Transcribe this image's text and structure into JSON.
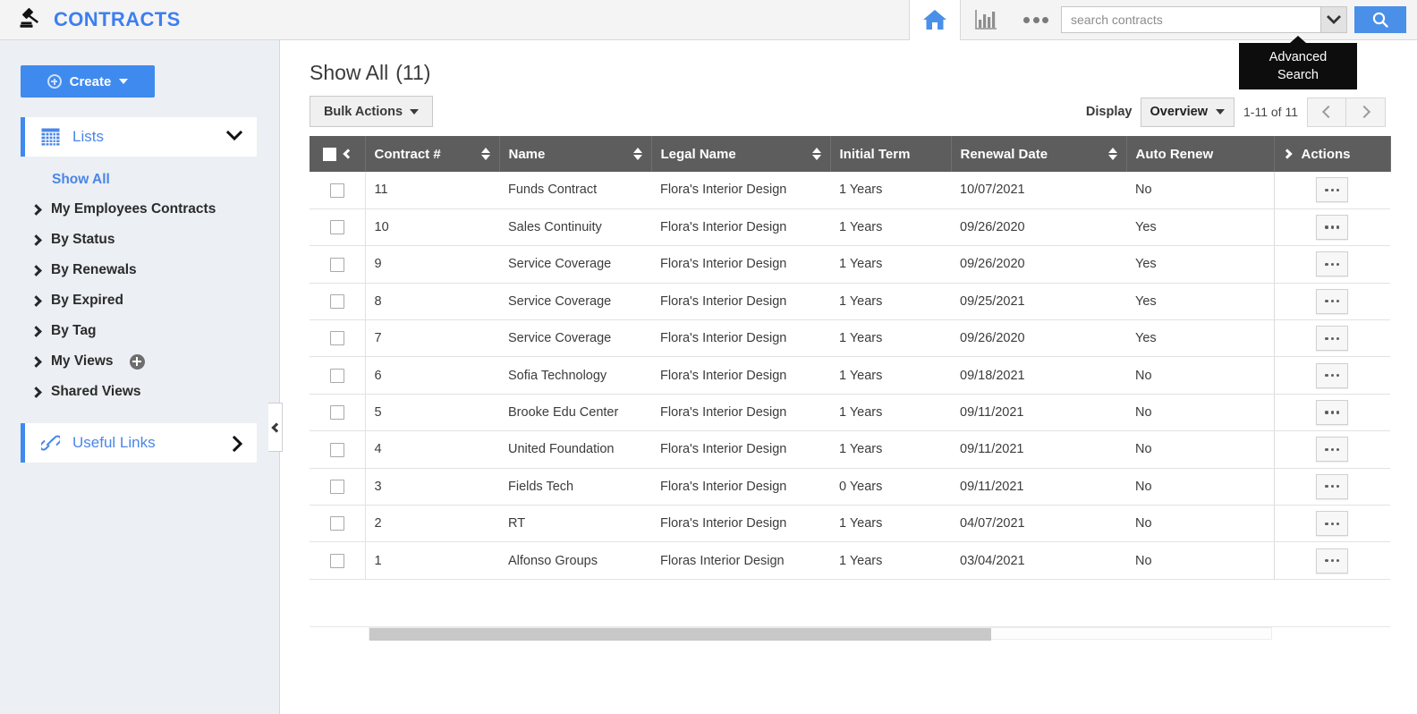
{
  "header": {
    "brand_title": "CONTRACTS",
    "gavel_icon": "gavel-icon",
    "home_icon": "home-icon",
    "chart_icon": "bar-chart-icon",
    "more_icon": "ellipsis-icon",
    "search_placeholder": "search contracts",
    "search_value": "",
    "search_caret_icon": "chevron-down-icon",
    "search_go_icon": "magnifier-icon",
    "tooltip_line1": "Advanced",
    "tooltip_line2": "Search"
  },
  "sidebar": {
    "create_label": "Create",
    "section": {
      "label": "Lists",
      "icon": "grid-icon",
      "chevron": "chevron-down-icon"
    },
    "show_all": "Show All",
    "items": [
      {
        "label": "My Employees Contracts",
        "has_add": false
      },
      {
        "label": "By Status",
        "has_add": false
      },
      {
        "label": "By Renewals",
        "has_add": false
      },
      {
        "label": "By Expired",
        "has_add": false
      },
      {
        "label": "By Tag",
        "has_add": false
      },
      {
        "label": "My Views",
        "has_add": true
      },
      {
        "label": "Shared Views",
        "has_add": false
      }
    ],
    "useful_links": {
      "label": "Useful Links",
      "icon": "link-icon",
      "chevron": "chevron-right-icon"
    },
    "collapse_icon": "chevron-left-icon"
  },
  "main": {
    "title": "Show All",
    "count": "(11)",
    "bulk_actions_label": "Bulk Actions",
    "display_label": "Display",
    "display_value": "Overview",
    "range_text": "1-11 of 11",
    "prev_icon": "chevron-left-icon",
    "next_icon": "chevron-right-icon"
  },
  "table": {
    "columns": [
      {
        "label": "Contract #",
        "sortable": true,
        "key": "contract_no"
      },
      {
        "label": "Name",
        "sortable": true,
        "key": "name"
      },
      {
        "label": "Legal Name",
        "sortable": true,
        "key": "legal_name"
      },
      {
        "label": "Initial Term",
        "sortable": false,
        "key": "initial_term"
      },
      {
        "label": "Renewal Date",
        "sortable": true,
        "key": "renewal_date"
      },
      {
        "label": "Auto Renew",
        "sortable": false,
        "key": "auto_renew"
      }
    ],
    "actions_header": "Actions",
    "rows": [
      {
        "contract_no": "11",
        "name": "Funds Contract",
        "legal_name": "Flora's Interior Design",
        "initial_term": "1 Years",
        "renewal_date": "10/07/2021",
        "auto_renew": "No"
      },
      {
        "contract_no": "10",
        "name": "Sales Continuity",
        "legal_name": "Flora's Interior Design",
        "initial_term": "1 Years",
        "renewal_date": "09/26/2020",
        "auto_renew": "Yes"
      },
      {
        "contract_no": "9",
        "name": "Service Coverage",
        "legal_name": "Flora's Interior Design",
        "initial_term": "1 Years",
        "renewal_date": "09/26/2020",
        "auto_renew": "Yes"
      },
      {
        "contract_no": "8",
        "name": "Service Coverage",
        "legal_name": "Flora's Interior Design",
        "initial_term": "1 Years",
        "renewal_date": "09/25/2021",
        "auto_renew": "Yes"
      },
      {
        "contract_no": "7",
        "name": "Service Coverage",
        "legal_name": "Flora's Interior Design",
        "initial_term": "1 Years",
        "renewal_date": "09/26/2020",
        "auto_renew": "Yes"
      },
      {
        "contract_no": "6",
        "name": "Sofia Technology",
        "legal_name": "Flora's Interior Design",
        "initial_term": "1 Years",
        "renewal_date": "09/18/2021",
        "auto_renew": "No"
      },
      {
        "contract_no": "5",
        "name": "Brooke Edu Center",
        "legal_name": "Flora's Interior Design",
        "initial_term": "1 Years",
        "renewal_date": "09/11/2021",
        "auto_renew": "No"
      },
      {
        "contract_no": "4",
        "name": "United Foundation",
        "legal_name": "Flora's Interior Design",
        "initial_term": "1 Years",
        "renewal_date": "09/11/2021",
        "auto_renew": "No"
      },
      {
        "contract_no": "3",
        "name": "Fields Tech",
        "legal_name": "Flora's Interior Design",
        "initial_term": "0 Years",
        "renewal_date": "09/11/2021",
        "auto_renew": "No"
      },
      {
        "contract_no": "2",
        "name": "RT",
        "legal_name": "Flora's Interior Design",
        "initial_term": "1 Years",
        "renewal_date": "04/07/2021",
        "auto_renew": "No"
      },
      {
        "contract_no": "1",
        "name": "Alfonso Groups",
        "legal_name": "Floras Interior Design",
        "initial_term": "1 Years",
        "renewal_date": "03/04/2021",
        "auto_renew": "No"
      }
    ]
  },
  "colors": {
    "accent_blue": "#3f8aee",
    "brand_blue": "#3d7ff0",
    "header_gray": "#5d5d5d",
    "sidebar_bg": "#eceff3",
    "tooltip_bg": "#0d0d0d"
  }
}
